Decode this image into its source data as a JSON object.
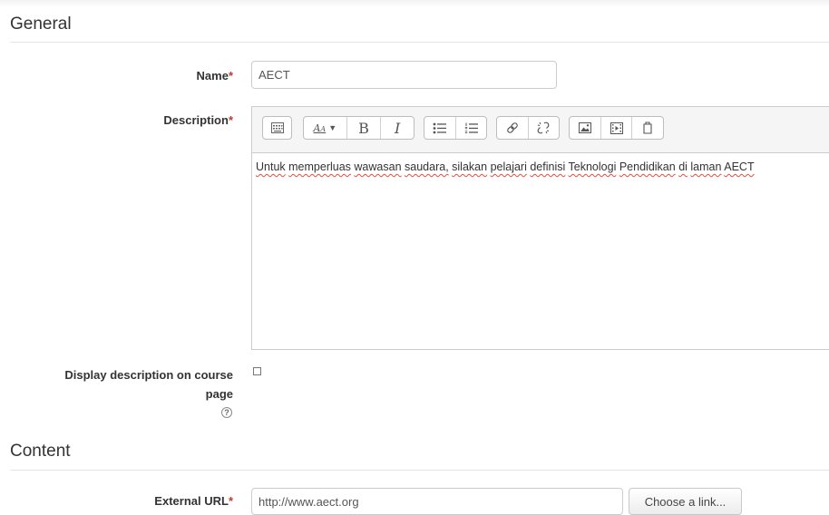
{
  "sections": {
    "general": "General",
    "content": "Content"
  },
  "form": {
    "name_label": "Name",
    "name_value": "AECT",
    "description_label": "Description",
    "description_text_words": [
      "Untuk",
      "memperluas",
      "wawasan",
      "saudara,",
      "silakan",
      "pelajari",
      "definisi",
      "Teknologi",
      "Pendidikan",
      "di",
      "laman",
      "AECT"
    ],
    "display_label_line1": "Display description on course",
    "display_label_line2": "page",
    "required_mark": "*",
    "help_glyph": "?",
    "external_url_label": "External URL",
    "external_url_value": "http://www.aect.org",
    "choose_link_button": "Choose a link..."
  },
  "toolbar": {
    "bold": "B",
    "italic": "I",
    "font_size_label": "A",
    "icons": [
      "toolbar-toggle-icon",
      "font-style-icon",
      "bold-icon",
      "italic-icon",
      "unordered-list-icon",
      "ordered-list-icon",
      "link-icon",
      "unlink-icon",
      "image-icon",
      "media-icon",
      "manage-files-icon"
    ]
  },
  "colors": {
    "required": "#c0392b",
    "spellcheck": "#e74c3c"
  },
  "display_on_course_page_checked": false
}
